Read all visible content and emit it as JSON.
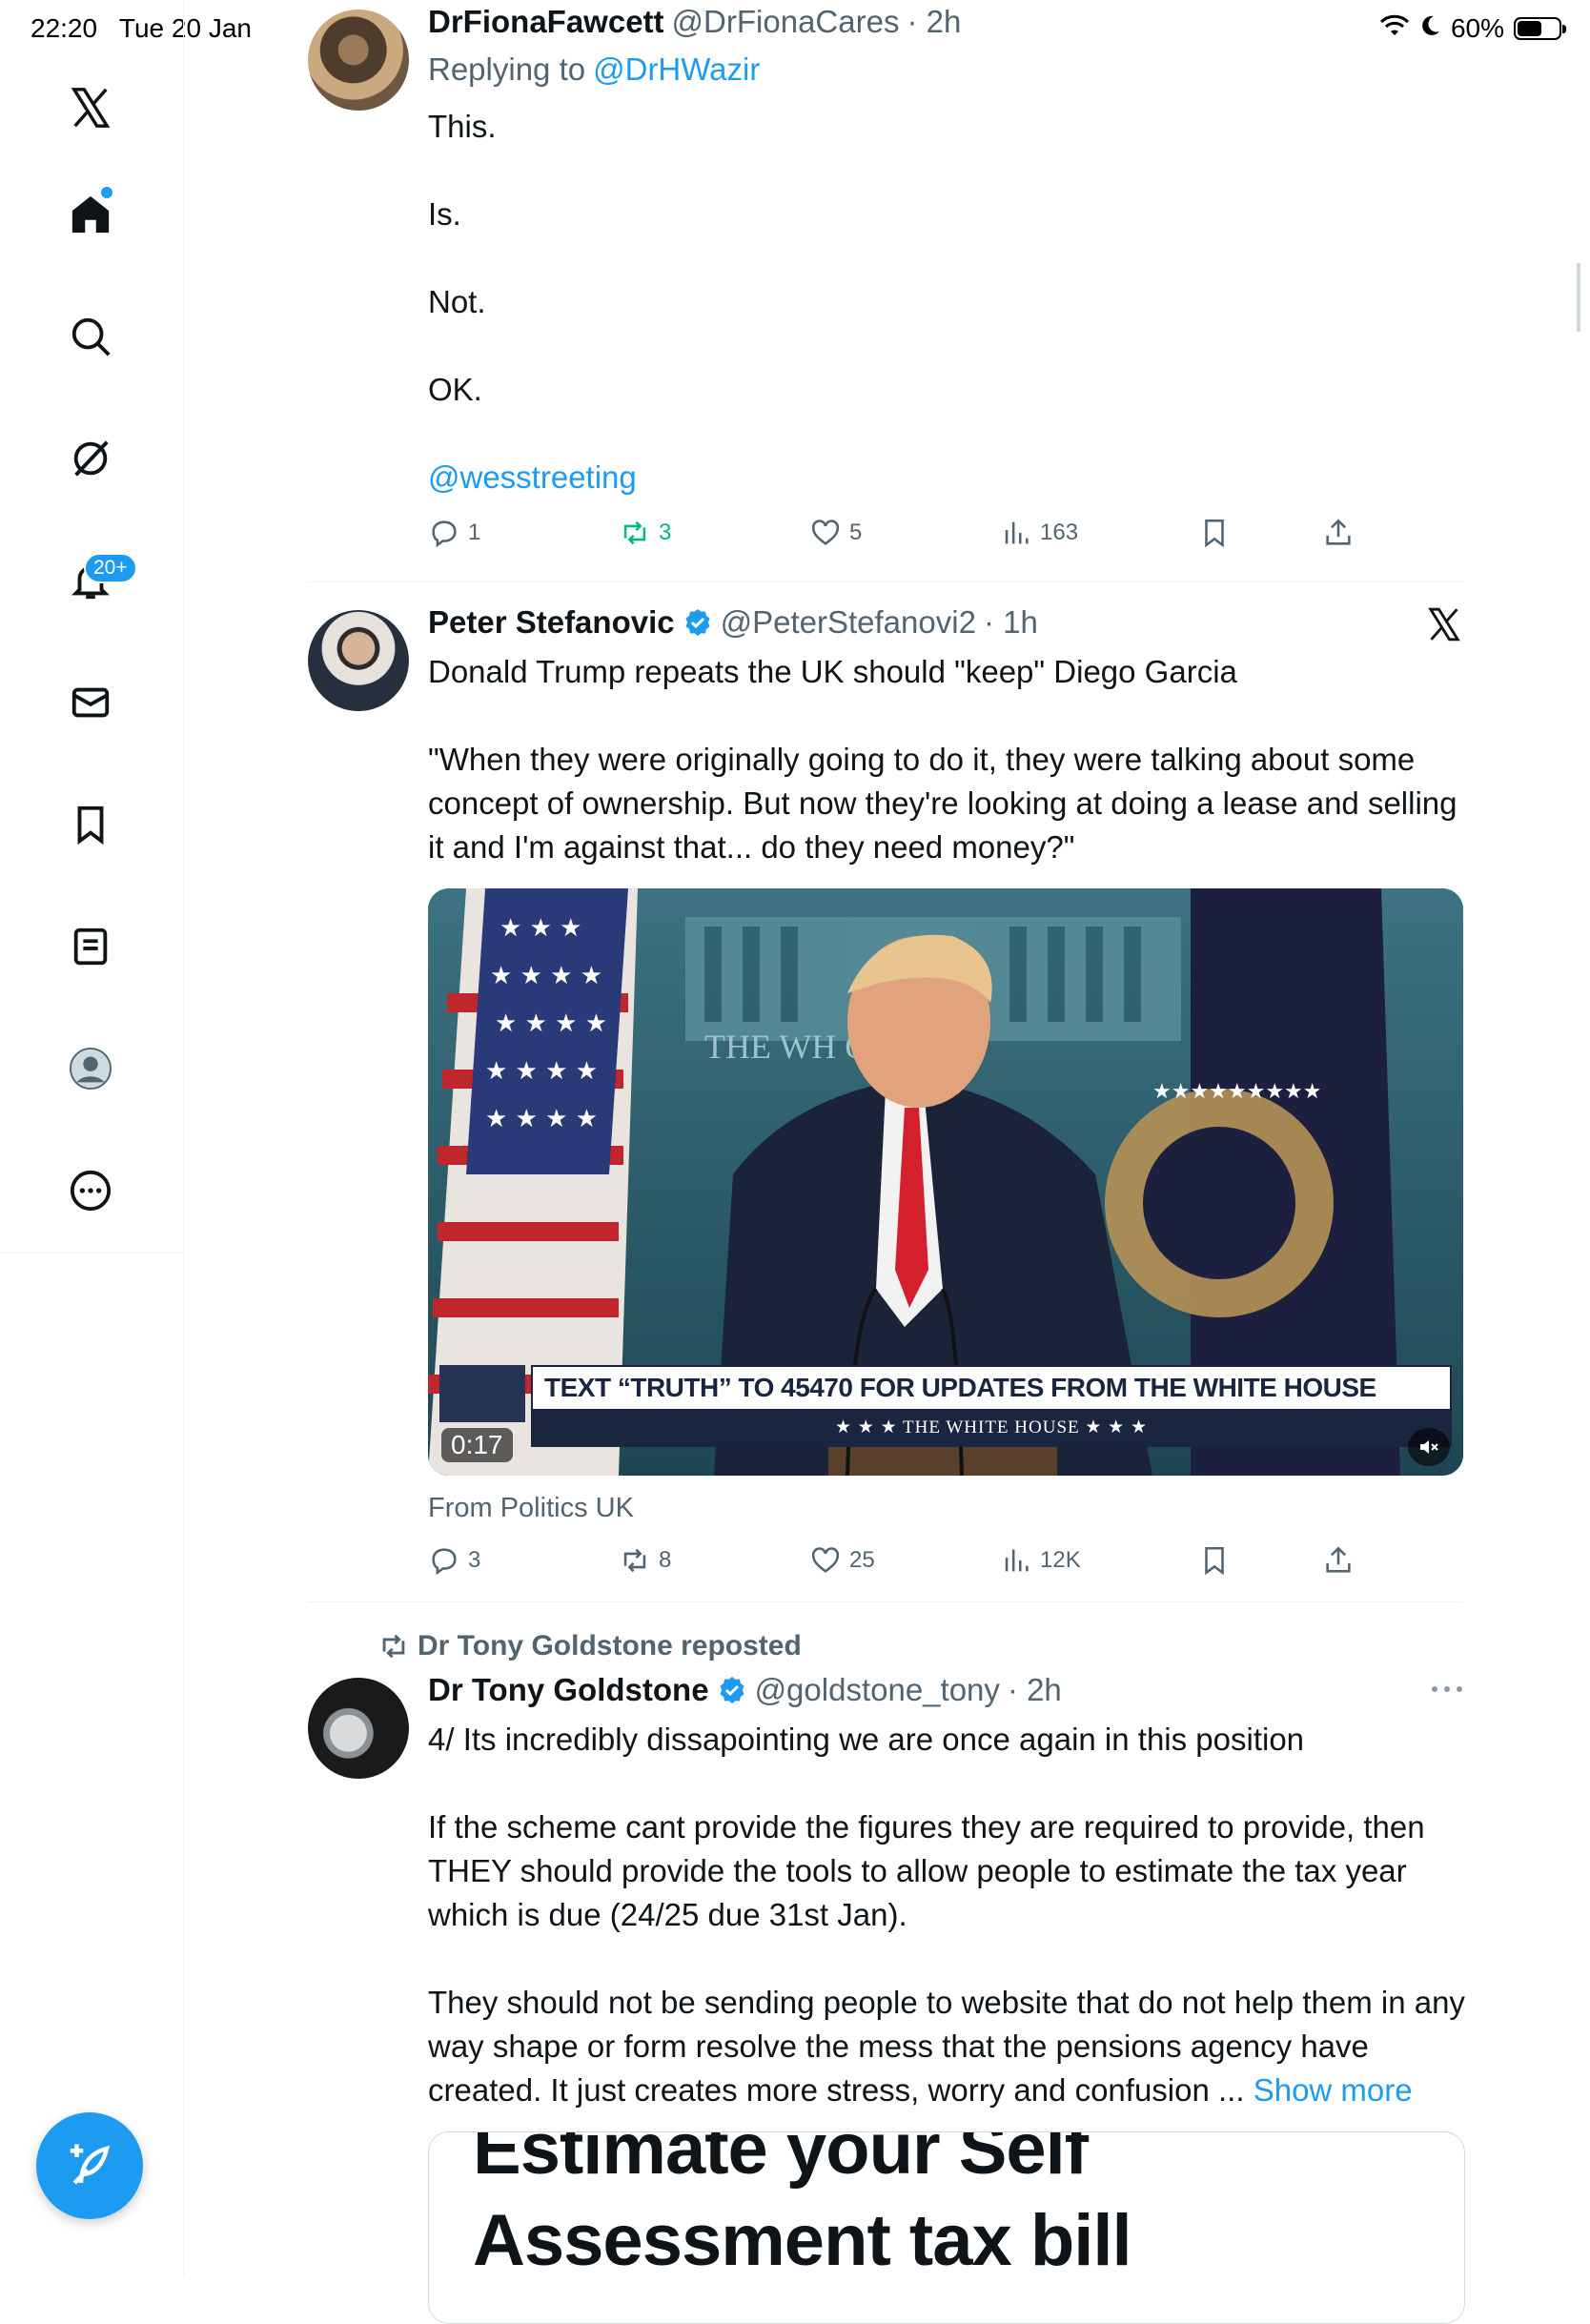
{
  "status_bar": {
    "time": "22:20",
    "date": "Tue 20 Jan",
    "battery": "60%",
    "battery_level": 0.6
  },
  "sidebar": {
    "items": [
      {
        "name": "x-logo-icon"
      },
      {
        "name": "home-icon"
      },
      {
        "name": "search-icon"
      },
      {
        "name": "grok-icon"
      },
      {
        "name": "notifications-icon"
      },
      {
        "name": "messages-icon"
      },
      {
        "name": "bookmarks-icon"
      },
      {
        "name": "lists-icon"
      },
      {
        "name": "profile-icon"
      },
      {
        "name": "more-icon"
      }
    ],
    "notifications_badge": "20+"
  },
  "tweets": [
    {
      "name": "DrFionaFawcett",
      "handle": "@DrFionaCares",
      "time": "· 2h",
      "replying_prefix": "Replying to",
      "replying_to": "@DrHWazir",
      "lines": [
        "This.",
        "Is.",
        "Not.",
        "OK."
      ],
      "mention": "@wesstreeting",
      "replies": "1",
      "reposts": "3",
      "likes": "5",
      "views": "163"
    },
    {
      "name": "Peter Stefanovic",
      "handle": "@PeterStefanovi2",
      "time": "· 1h",
      "line1": "Donald Trump repeats the UK should \"keep\" Diego Garcia",
      "quote": "\"When they were originally going to do it, they were talking about some concept of ownership. But now they're looking at doing a lease and selling it and I'm against that... do they need money?\"",
      "video": {
        "banner": "TEXT “TRUTH” TO 45470 FOR UPDATES FROM THE WHITE HOUSE",
        "sub_banner": "★ ★ ★   THE WHITE HOUSE   ★ ★ ★",
        "backdrop_text": "THE WH        OUSE",
        "duration": "0:17"
      },
      "source": "From Politics UK",
      "replies": "3",
      "reposts": "8",
      "likes": "25",
      "views": "12K"
    },
    {
      "reposted_by": "Dr Tony Goldstone reposted",
      "name": "Dr Tony Goldstone",
      "handle": "@goldstone_tony",
      "time": "· 2h",
      "p1": "4/ Its incredibly dissapointing we are once again in this position",
      "p2": "If the scheme cant provide the figures they are required to provide, then THEY should provide the tools to allow people to estimate the tax year which is due (24/25 due 31st Jan).",
      "p3": "They should not be sending people to website that do not help them in any way shape or form resolve the mess that the pensions agency have created. It just creates more stress, worry and confusion ...",
      "show_more": "Show more",
      "card_line1": "Estimate your Self",
      "card_line2": "Assessment tax bill"
    }
  ],
  "colors": {
    "accent": "#1d9bf0",
    "text": "#0f1419",
    "muted": "#536471",
    "repost_green": "#00ba7c"
  }
}
